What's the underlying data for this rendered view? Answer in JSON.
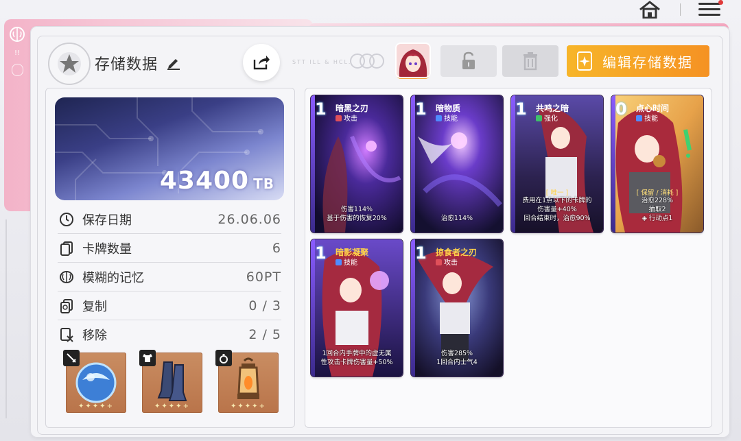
{
  "header": {
    "title": "存储数据",
    "deco_text": "STT ILL & HCL.",
    "edit_button_label": "编辑存储数据"
  },
  "storage": {
    "value": "43400",
    "unit": "TB"
  },
  "stats": [
    {
      "label": "保存日期",
      "value": "26.06.06",
      "icon": "clock-icon"
    },
    {
      "label": "卡牌数量",
      "value": "6",
      "icon": "cards-icon"
    },
    {
      "label": "模糊的记忆",
      "value": "60PT",
      "icon": "brain-icon"
    },
    {
      "label": "复制",
      "value": "0 / 3",
      "icon": "copy-icon"
    },
    {
      "label": "移除",
      "value": "2 / 5",
      "icon": "remove-icon"
    }
  ],
  "relics": [
    {
      "name": "orb",
      "slot": "sword-icon",
      "stars": "✦✦✦✦+"
    },
    {
      "name": "boots",
      "slot": "armor-icon",
      "stars": "✦✦✦✦+"
    },
    {
      "name": "lantern",
      "slot": "ring-icon",
      "stars": "✦✦✦✦+"
    }
  ],
  "cards": [
    {
      "cost": "1",
      "name": "暗黑之刃",
      "type": "攻击",
      "type_color": "#e0505a",
      "desc": [
        "伤害114%",
        "基于伤害的恢复20%"
      ],
      "tag": ""
    },
    {
      "cost": "1",
      "name": "暗物质",
      "type": "技能",
      "type_color": "#4f8cff",
      "desc": [
        "治愈114%"
      ],
      "tag": ""
    },
    {
      "cost": "1",
      "name": "共鸣之暗",
      "type": "强化",
      "type_color": "#3fc06a",
      "desc": [
        "费用在1点以下的卡牌的",
        "伤害量+40%",
        "回合结束时，治愈90%"
      ],
      "tag": "[ 唯一 ]"
    },
    {
      "cost": "0",
      "name": "点心时间",
      "type": "技能",
      "type_color": "#4f8cff",
      "desc": [
        "治愈228%",
        "抽取2",
        "◈ 行动点1"
      ],
      "tag": "[ 保留 / 消耗 ]"
    },
    {
      "cost": "1",
      "name": "暗影凝聚",
      "type": "技能",
      "type_color": "#4f8cff",
      "desc": [
        "1回合内手牌中的虚无属",
        "性攻击卡牌伤害量+50%"
      ],
      "tag": ""
    },
    {
      "cost": "1",
      "name": "掠食者之刃",
      "type": "攻击",
      "type_color": "#e0505a",
      "desc": [
        "伤害285%",
        "1回合内士气4"
      ],
      "tag": ""
    }
  ],
  "colors": {
    "accent_orange": "#f59223",
    "pink": "#f3a7c0"
  }
}
